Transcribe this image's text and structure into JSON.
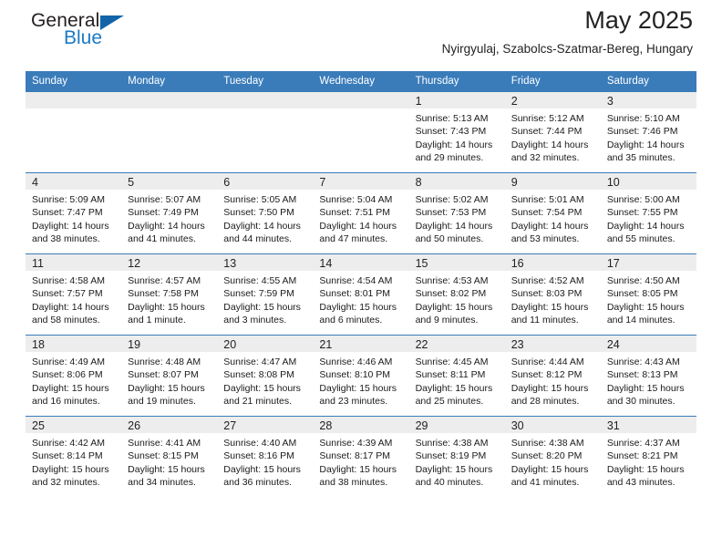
{
  "brand": {
    "name_part1": "General",
    "name_part2": "Blue",
    "accent_color": "#1b79c4",
    "triangle_color": "#1164a8"
  },
  "header": {
    "title": "May 2025",
    "subtitle": "Nyirgyulaj, Szabolcs-Szatmar-Bereg, Hungary"
  },
  "calendar": {
    "header_bg": "#3a7cba",
    "daynum_bg": "#ededed",
    "weekday_headers": [
      "Sunday",
      "Monday",
      "Tuesday",
      "Wednesday",
      "Thursday",
      "Friday",
      "Saturday"
    ],
    "weeks": [
      [
        {
          "day": "",
          "lines": []
        },
        {
          "day": "",
          "lines": []
        },
        {
          "day": "",
          "lines": []
        },
        {
          "day": "",
          "lines": []
        },
        {
          "day": "1",
          "lines": [
            "Sunrise: 5:13 AM",
            "Sunset: 7:43 PM",
            "Daylight: 14 hours",
            "and 29 minutes."
          ]
        },
        {
          "day": "2",
          "lines": [
            "Sunrise: 5:12 AM",
            "Sunset: 7:44 PM",
            "Daylight: 14 hours",
            "and 32 minutes."
          ]
        },
        {
          "day": "3",
          "lines": [
            "Sunrise: 5:10 AM",
            "Sunset: 7:46 PM",
            "Daylight: 14 hours",
            "and 35 minutes."
          ]
        }
      ],
      [
        {
          "day": "4",
          "lines": [
            "Sunrise: 5:09 AM",
            "Sunset: 7:47 PM",
            "Daylight: 14 hours",
            "and 38 minutes."
          ]
        },
        {
          "day": "5",
          "lines": [
            "Sunrise: 5:07 AM",
            "Sunset: 7:49 PM",
            "Daylight: 14 hours",
            "and 41 minutes."
          ]
        },
        {
          "day": "6",
          "lines": [
            "Sunrise: 5:05 AM",
            "Sunset: 7:50 PM",
            "Daylight: 14 hours",
            "and 44 minutes."
          ]
        },
        {
          "day": "7",
          "lines": [
            "Sunrise: 5:04 AM",
            "Sunset: 7:51 PM",
            "Daylight: 14 hours",
            "and 47 minutes."
          ]
        },
        {
          "day": "8",
          "lines": [
            "Sunrise: 5:02 AM",
            "Sunset: 7:53 PM",
            "Daylight: 14 hours",
            "and 50 minutes."
          ]
        },
        {
          "day": "9",
          "lines": [
            "Sunrise: 5:01 AM",
            "Sunset: 7:54 PM",
            "Daylight: 14 hours",
            "and 53 minutes."
          ]
        },
        {
          "day": "10",
          "lines": [
            "Sunrise: 5:00 AM",
            "Sunset: 7:55 PM",
            "Daylight: 14 hours",
            "and 55 minutes."
          ]
        }
      ],
      [
        {
          "day": "11",
          "lines": [
            "Sunrise: 4:58 AM",
            "Sunset: 7:57 PM",
            "Daylight: 14 hours",
            "and 58 minutes."
          ]
        },
        {
          "day": "12",
          "lines": [
            "Sunrise: 4:57 AM",
            "Sunset: 7:58 PM",
            "Daylight: 15 hours",
            "and 1 minute."
          ]
        },
        {
          "day": "13",
          "lines": [
            "Sunrise: 4:55 AM",
            "Sunset: 7:59 PM",
            "Daylight: 15 hours",
            "and 3 minutes."
          ]
        },
        {
          "day": "14",
          "lines": [
            "Sunrise: 4:54 AM",
            "Sunset: 8:01 PM",
            "Daylight: 15 hours",
            "and 6 minutes."
          ]
        },
        {
          "day": "15",
          "lines": [
            "Sunrise: 4:53 AM",
            "Sunset: 8:02 PM",
            "Daylight: 15 hours",
            "and 9 minutes."
          ]
        },
        {
          "day": "16",
          "lines": [
            "Sunrise: 4:52 AM",
            "Sunset: 8:03 PM",
            "Daylight: 15 hours",
            "and 11 minutes."
          ]
        },
        {
          "day": "17",
          "lines": [
            "Sunrise: 4:50 AM",
            "Sunset: 8:05 PM",
            "Daylight: 15 hours",
            "and 14 minutes."
          ]
        }
      ],
      [
        {
          "day": "18",
          "lines": [
            "Sunrise: 4:49 AM",
            "Sunset: 8:06 PM",
            "Daylight: 15 hours",
            "and 16 minutes."
          ]
        },
        {
          "day": "19",
          "lines": [
            "Sunrise: 4:48 AM",
            "Sunset: 8:07 PM",
            "Daylight: 15 hours",
            "and 19 minutes."
          ]
        },
        {
          "day": "20",
          "lines": [
            "Sunrise: 4:47 AM",
            "Sunset: 8:08 PM",
            "Daylight: 15 hours",
            "and 21 minutes."
          ]
        },
        {
          "day": "21",
          "lines": [
            "Sunrise: 4:46 AM",
            "Sunset: 8:10 PM",
            "Daylight: 15 hours",
            "and 23 minutes."
          ]
        },
        {
          "day": "22",
          "lines": [
            "Sunrise: 4:45 AM",
            "Sunset: 8:11 PM",
            "Daylight: 15 hours",
            "and 25 minutes."
          ]
        },
        {
          "day": "23",
          "lines": [
            "Sunrise: 4:44 AM",
            "Sunset: 8:12 PM",
            "Daylight: 15 hours",
            "and 28 minutes."
          ]
        },
        {
          "day": "24",
          "lines": [
            "Sunrise: 4:43 AM",
            "Sunset: 8:13 PM",
            "Daylight: 15 hours",
            "and 30 minutes."
          ]
        }
      ],
      [
        {
          "day": "25",
          "lines": [
            "Sunrise: 4:42 AM",
            "Sunset: 8:14 PM",
            "Daylight: 15 hours",
            "and 32 minutes."
          ]
        },
        {
          "day": "26",
          "lines": [
            "Sunrise: 4:41 AM",
            "Sunset: 8:15 PM",
            "Daylight: 15 hours",
            "and 34 minutes."
          ]
        },
        {
          "day": "27",
          "lines": [
            "Sunrise: 4:40 AM",
            "Sunset: 8:16 PM",
            "Daylight: 15 hours",
            "and 36 minutes."
          ]
        },
        {
          "day": "28",
          "lines": [
            "Sunrise: 4:39 AM",
            "Sunset: 8:17 PM",
            "Daylight: 15 hours",
            "and 38 minutes."
          ]
        },
        {
          "day": "29",
          "lines": [
            "Sunrise: 4:38 AM",
            "Sunset: 8:19 PM",
            "Daylight: 15 hours",
            "and 40 minutes."
          ]
        },
        {
          "day": "30",
          "lines": [
            "Sunrise: 4:38 AM",
            "Sunset: 8:20 PM",
            "Daylight: 15 hours",
            "and 41 minutes."
          ]
        },
        {
          "day": "31",
          "lines": [
            "Sunrise: 4:37 AM",
            "Sunset: 8:21 PM",
            "Daylight: 15 hours",
            "and 43 minutes."
          ]
        }
      ]
    ]
  }
}
